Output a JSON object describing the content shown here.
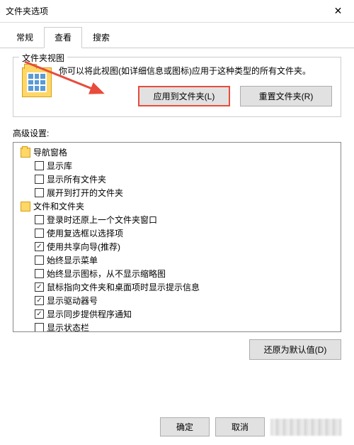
{
  "window": {
    "title": "文件夹选项"
  },
  "tabs": {
    "t0": "常规",
    "t1": "查看",
    "t2": "搜索",
    "active": 1
  },
  "folderView": {
    "groupLabel": "文件夹视图",
    "description": "你可以将此视图(如详细信息或图标)应用于这种类型的所有文件夹。",
    "applyBtn": "应用到文件夹(L)",
    "resetBtn": "重置文件夹(R)"
  },
  "advanced": {
    "label": "高级设置:",
    "groups": [
      {
        "type": "header",
        "icon": "nav",
        "label": "导航窗格"
      },
      {
        "type": "check",
        "checked": false,
        "label": "显示库"
      },
      {
        "type": "check",
        "checked": false,
        "label": "显示所有文件夹"
      },
      {
        "type": "check",
        "checked": false,
        "label": "展开到打开的文件夹"
      },
      {
        "type": "header",
        "icon": "folder",
        "label": "文件和文件夹"
      },
      {
        "type": "check",
        "checked": false,
        "label": "登录时还原上一个文件夹窗口"
      },
      {
        "type": "check",
        "checked": false,
        "label": "使用复选框以选择项"
      },
      {
        "type": "check",
        "checked": true,
        "label": "使用共享向导(推荐)"
      },
      {
        "type": "check",
        "checked": false,
        "label": "始终显示菜单"
      },
      {
        "type": "check",
        "checked": false,
        "label": "始终显示图标，从不显示缩略图"
      },
      {
        "type": "check",
        "checked": true,
        "label": "鼠标指向文件夹和桌面项时显示提示信息"
      },
      {
        "type": "check",
        "checked": true,
        "label": "显示驱动器号"
      },
      {
        "type": "check",
        "checked": true,
        "label": "显示同步提供程序通知"
      },
      {
        "type": "check",
        "checked": false,
        "label": "显示状态栏"
      }
    ],
    "restoreBtn": "还原为默认值(D)"
  },
  "footer": {
    "ok": "确定",
    "cancel": "取消"
  }
}
